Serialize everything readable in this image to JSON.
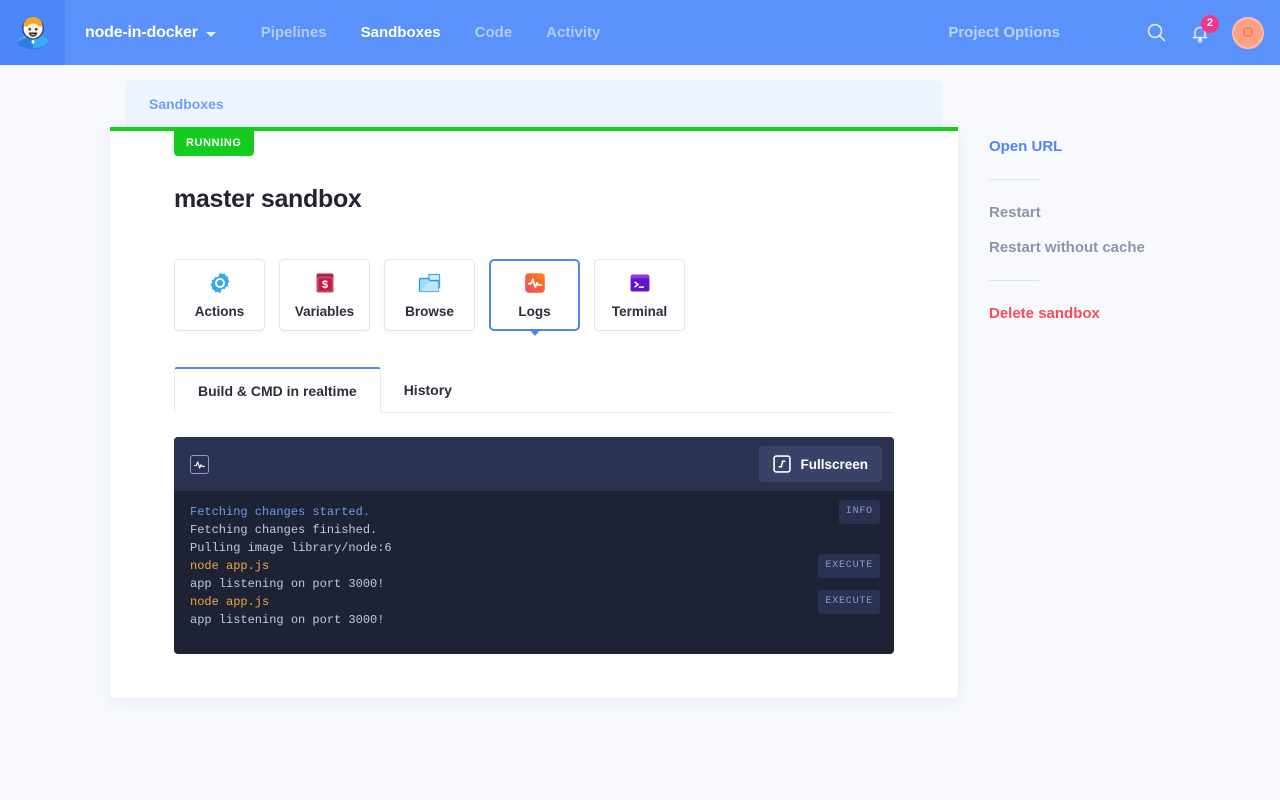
{
  "header": {
    "logo_icon": "buddy-astronaut-logo",
    "brand": "node-in-docker",
    "caret_icon": "chevron-down-icon",
    "nav": [
      {
        "label": "Pipelines",
        "active": false
      },
      {
        "label": "Sandboxes",
        "active": true
      },
      {
        "label": "Code",
        "active": false
      },
      {
        "label": "Activity",
        "active": false
      }
    ],
    "project_options": "Project Options",
    "search_icon": "search-icon",
    "bell_icon": "bell-icon",
    "notification_count": "2",
    "avatar_initial": "O",
    "bg_color": "#5b91fa",
    "badge_color": "#f3368c"
  },
  "breadcrumb": {
    "label": "Sandboxes"
  },
  "card": {
    "status": "RUNNING",
    "status_color": "#14cc1e",
    "title": "master sandbox"
  },
  "tiles": [
    {
      "label": "Actions",
      "icon": "gear-icon",
      "active": false
    },
    {
      "label": "Variables",
      "icon": "book-dollar-icon",
      "active": false
    },
    {
      "label": "Browse",
      "icon": "folder-icon",
      "active": false
    },
    {
      "label": "Logs",
      "icon": "pulse-icon",
      "active": true
    },
    {
      "label": "Terminal",
      "icon": "terminal-icon",
      "active": false
    }
  ],
  "tabs": [
    {
      "label": "Build & CMD in realtime",
      "active": true
    },
    {
      "label": "History",
      "active": false
    }
  ],
  "console": {
    "header_icon": "pulse-box-icon",
    "fullscreen_icon": "fullscreen-icon",
    "fullscreen_label": "Fullscreen",
    "lines": [
      {
        "text": "Fetching changes started.",
        "style": "info",
        "tag": "INFO"
      },
      {
        "text": "Fetching changes finished.",
        "style": "plain",
        "tag": ""
      },
      {
        "text": "Pulling image library/node:6",
        "style": "plain",
        "tag": ""
      },
      {
        "text": "node app.js",
        "style": "cmd",
        "tag": "EXECUTE"
      },
      {
        "text": "app listening on port 3000!",
        "style": "plain",
        "tag": ""
      },
      {
        "text": "node app.js",
        "style": "cmd",
        "tag": "EXECUTE"
      },
      {
        "text": "app listening on port 3000!",
        "style": "plain",
        "tag": ""
      }
    ]
  },
  "sidebar": {
    "open_url": "Open URL",
    "restart": "Restart",
    "restart_no_cache": "Restart without cache",
    "delete": "Delete sandbox"
  }
}
